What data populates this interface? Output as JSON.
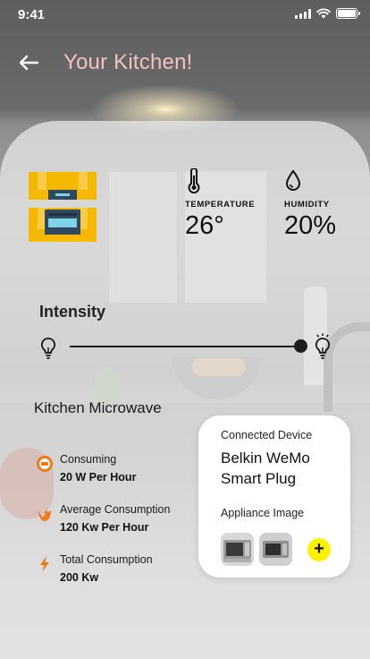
{
  "status_bar": {
    "time": "9:41"
  },
  "header": {
    "title": "Your Kitchen!",
    "back_icon": "arrow-left-icon"
  },
  "sensors": {
    "temperature": {
      "label": "TEMPERATURE",
      "value": "26°",
      "icon": "thermometer-icon"
    },
    "humidity": {
      "label": "HUMIDITY",
      "value": "20%",
      "icon": "droplet-icon"
    }
  },
  "intensity": {
    "label": "Intensity",
    "level": 0.97
  },
  "device": {
    "name": "Kitchen Microwave",
    "stats": [
      {
        "label": "Consuming",
        "value": "20 W Per Hour",
        "icon": "energy-meter-icon"
      },
      {
        "label": "Average Consumption",
        "value": "120 Kw Per Hour",
        "icon": "flame-energy-icon"
      },
      {
        "label": "Total Consumption",
        "value": "200 Kw",
        "icon": "lightning-bolt-icon"
      }
    ]
  },
  "connected_device": {
    "label": "Connected Device",
    "name": "Belkin WeMo Smart Plug",
    "image_label": "Appliance Image",
    "add_icon": "plus-icon"
  },
  "colors": {
    "title": "#f4c0c0",
    "appliance_accent": "#f5b800",
    "stat_icon": "#f07a1a",
    "add_button": "#fff200"
  }
}
